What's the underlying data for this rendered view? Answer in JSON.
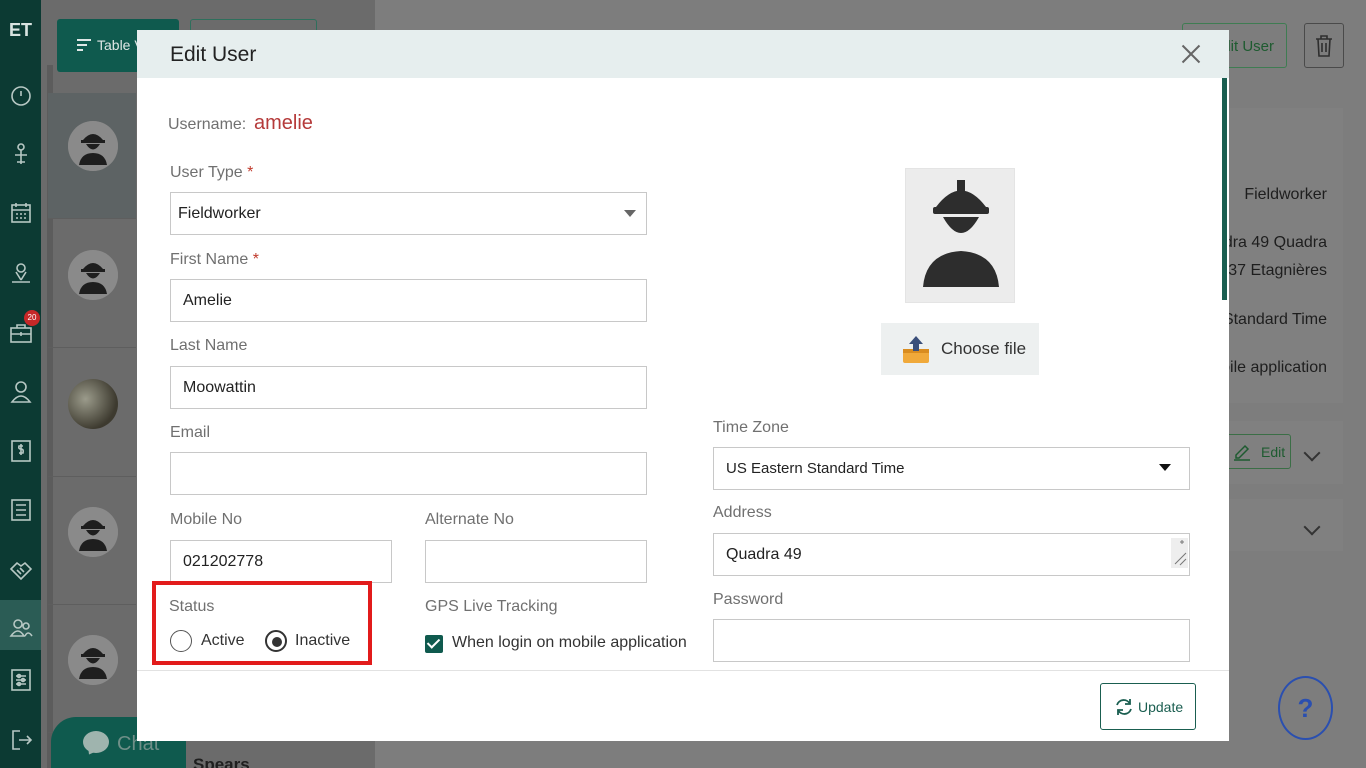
{
  "sidebar": {
    "logo": "ET",
    "badge_count": "20",
    "icons": [
      "dashboard-icon",
      "pin-icon",
      "calendar-icon",
      "map-icon",
      "briefcase-icon",
      "user-icon",
      "invoice-icon",
      "list-icon",
      "handshake-icon",
      "users-icon",
      "settings-icon",
      "logout-icon"
    ]
  },
  "background": {
    "table_view_label": "Table V",
    "edit_user_label": "dit User",
    "detail_lines": [
      "Fieldworker",
      "dra 49 Quadra",
      "037 Etagnières",
      "Standard Time",
      "bile application"
    ],
    "edit_label": "Edit",
    "chat_label": "Chat",
    "list_name_partial": "Spears",
    "help_label": "?"
  },
  "modal": {
    "title": "Edit User",
    "username_label": "Username:",
    "username_value": "amelie",
    "user_type": {
      "label": "User Type",
      "required": "*",
      "value": "Fieldworker"
    },
    "first_name": {
      "label": "First Name",
      "required": "*",
      "value": "Amelie"
    },
    "last_name": {
      "label": "Last Name",
      "value": "Moowattin"
    },
    "email": {
      "label": "Email",
      "value": ""
    },
    "mobile_no": {
      "label": "Mobile No",
      "value": "021202778"
    },
    "alternate_no": {
      "label": "Alternate No",
      "value": ""
    },
    "status": {
      "label": "Status",
      "options": [
        "Active",
        "Inactive"
      ],
      "selected": "Inactive"
    },
    "gps": {
      "label": "GPS Live Tracking",
      "option": "When login on mobile application",
      "checked": true
    },
    "choose_file_label": "Choose file",
    "time_zone": {
      "label": "Time Zone",
      "value": "US Eastern Standard Time"
    },
    "address": {
      "label": "Address",
      "value": "Quadra 49"
    },
    "password": {
      "label": "Password",
      "value": ""
    },
    "update_label": "Update"
  },
  "colors": {
    "brand": "#0f5a4e",
    "accent_red": "#e21b1b",
    "username": "#b53a3a"
  }
}
